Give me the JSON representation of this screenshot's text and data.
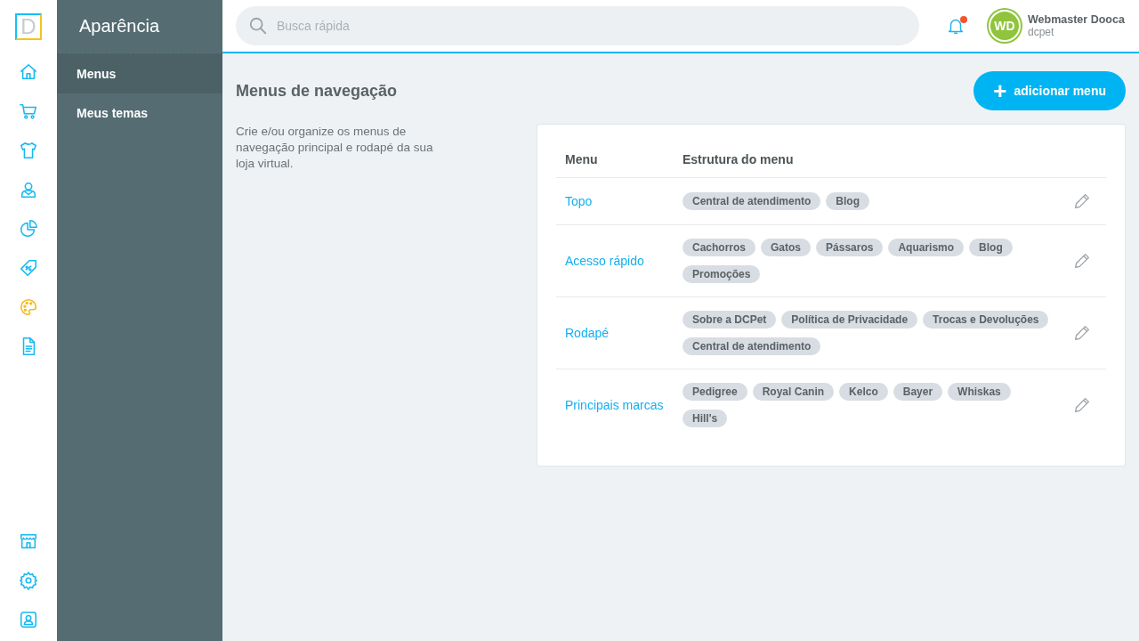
{
  "logo": {
    "letter": "D"
  },
  "rail": {
    "top": [
      {
        "kind": "home",
        "selected": false
      },
      {
        "kind": "cart",
        "selected": false
      },
      {
        "kind": "shirt",
        "selected": false
      },
      {
        "kind": "user",
        "selected": false
      },
      {
        "kind": "chart",
        "selected": false
      },
      {
        "kind": "tag",
        "selected": false
      },
      {
        "kind": "palette",
        "selected": true
      },
      {
        "kind": "document",
        "selected": false
      }
    ],
    "bottom": [
      {
        "kind": "store",
        "selected": false
      },
      {
        "kind": "gear",
        "selected": false
      },
      {
        "kind": "contact",
        "selected": false
      }
    ]
  },
  "sidebar": {
    "title": "Aparência",
    "items": [
      {
        "label": "Menus",
        "selected": true
      },
      {
        "label": "Meus temas",
        "selected": false
      }
    ]
  },
  "header": {
    "search": {
      "placeholder": "Busca rápida"
    },
    "notifications": {
      "unread": true
    },
    "user": {
      "initials": "WD",
      "name": "Webmaster Dooca",
      "store": "dcpet"
    }
  },
  "page": {
    "title": "Menus de navegação",
    "add_button": {
      "icon": "+",
      "label": "adicionar menu"
    },
    "description": "Crie e/ou organize os menus de navegação principal e rodapé da sua loja virtual."
  },
  "table": {
    "columns": [
      "Menu",
      "Estrutura do menu"
    ],
    "rows": [
      {
        "menu": "Topo",
        "items": [
          "Central de atendimento",
          "Blog"
        ]
      },
      {
        "menu": "Acesso rápido",
        "items": [
          "Cachorros",
          "Gatos",
          "Pássaros",
          "Aquarismo",
          "Blog",
          "Promoções"
        ]
      },
      {
        "menu": "Rodapé",
        "items": [
          "Sobre a DCPet",
          "Política de Privacidade",
          "Trocas e Devoluções",
          "Central de atendimento"
        ]
      },
      {
        "menu": "Principais marcas",
        "items": [
          "Pedigree",
          "Royal Canin",
          "Kelco",
          "Bayer",
          "Whiskas",
          "Hill's"
        ]
      }
    ]
  }
}
